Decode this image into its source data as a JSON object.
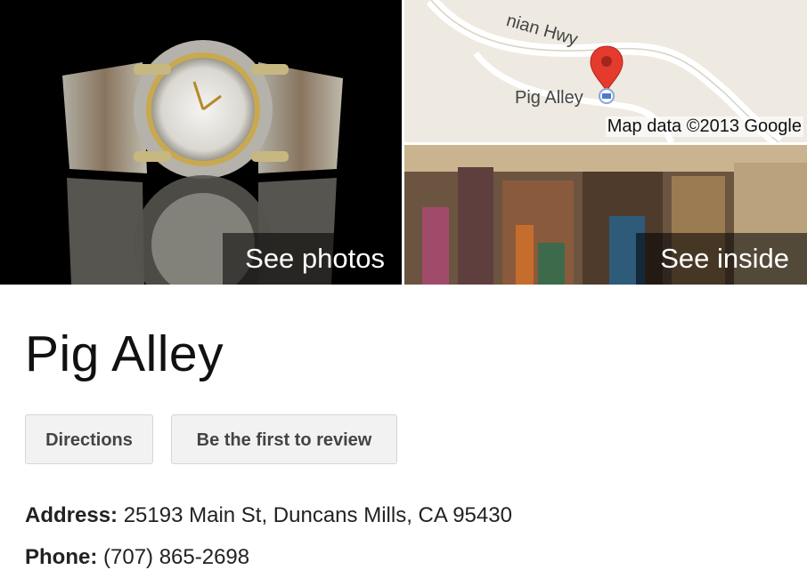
{
  "photos": {
    "overlay_label": "See photos"
  },
  "map": {
    "road_label": "nian Hwy",
    "place_label": "Pig Alley",
    "attribution": "Map data ©2013 Google"
  },
  "inside": {
    "overlay_label": "See inside"
  },
  "place": {
    "name": "Pig Alley"
  },
  "actions": {
    "directions_label": "Directions",
    "review_label": "Be the first to review"
  },
  "details": {
    "address_label": "Address:",
    "address_value": "25193 Main St, Duncans Mills, CA 95430",
    "phone_label": "Phone:",
    "phone_value": "(707) 865-2698"
  },
  "colors": {
    "pin": "#e53b2f",
    "map_bg": "#eeeae1",
    "button_bg": "#f2f2f2"
  }
}
